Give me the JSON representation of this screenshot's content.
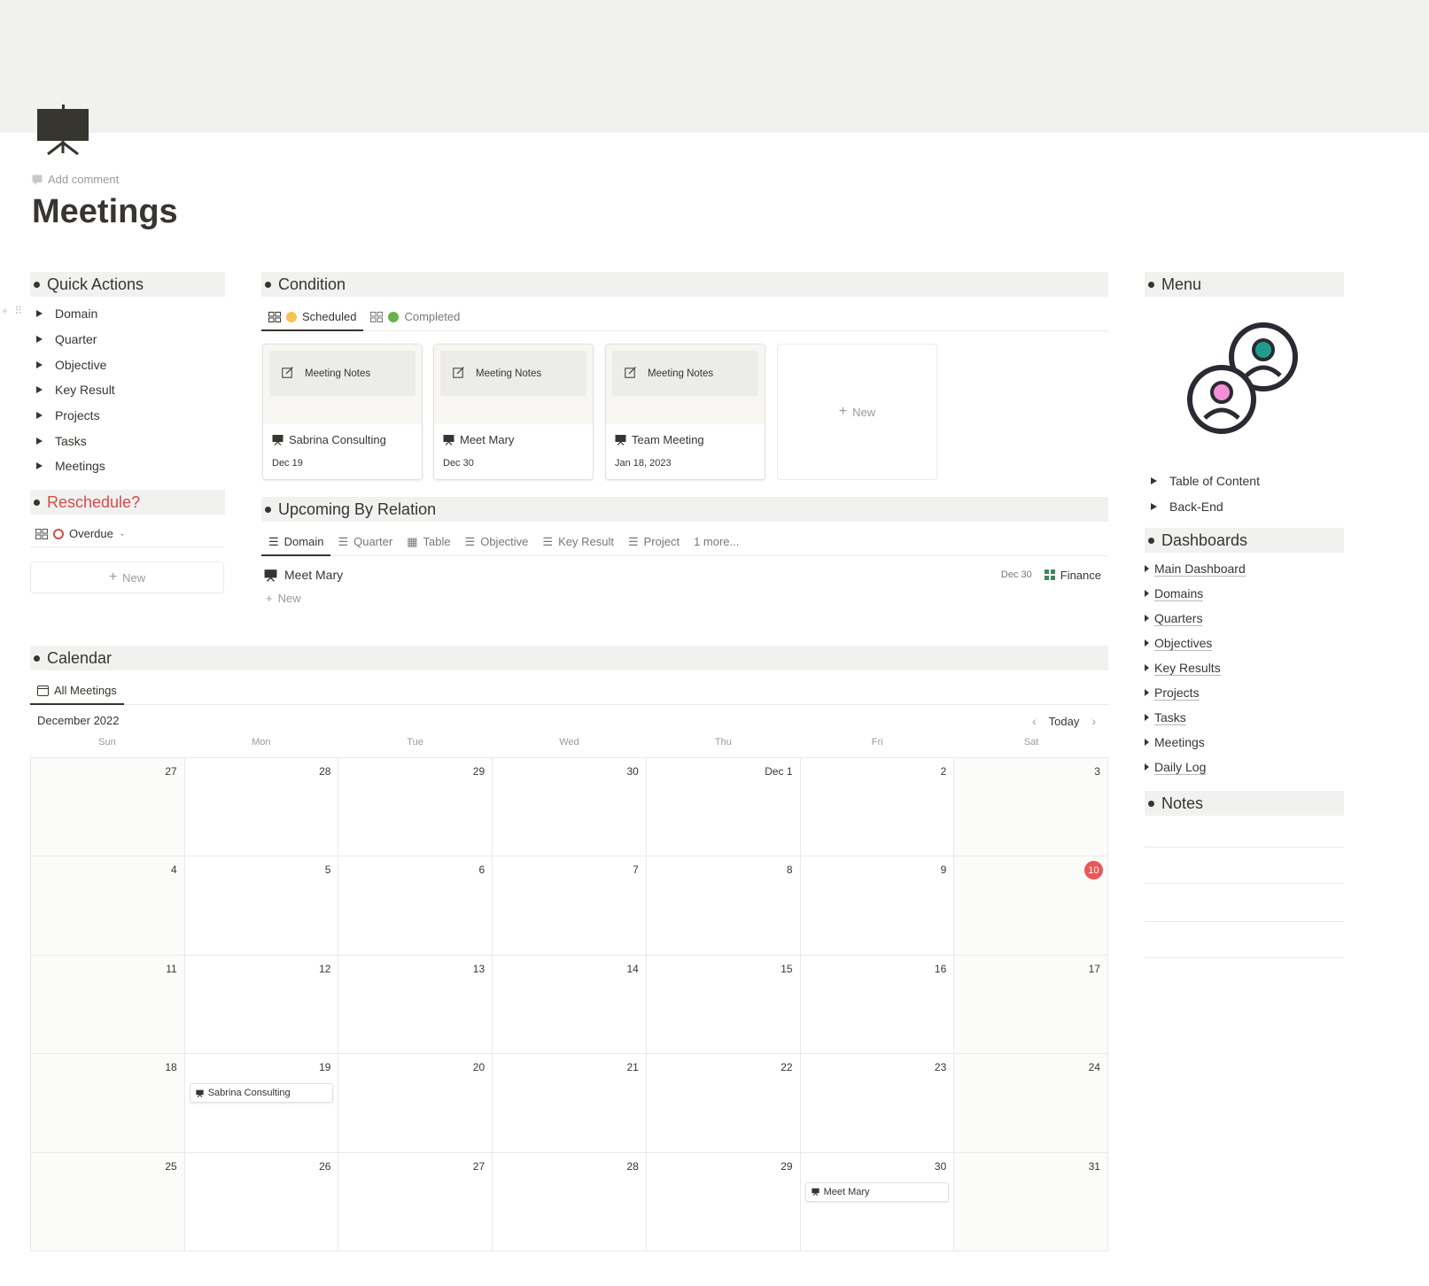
{
  "page": {
    "title": "Meetings",
    "add_comment": "Add comment"
  },
  "quick_actions": {
    "heading": "Quick Actions",
    "items": [
      "Domain",
      "Quarter",
      "Objective",
      "Key Result",
      "Projects",
      "Tasks",
      "Meetings"
    ]
  },
  "reschedule": {
    "heading": "Reschedule?",
    "view_label": "Overdue",
    "new_label": "New"
  },
  "condition": {
    "heading": "Condition",
    "tabs": [
      {
        "label": "Scheduled",
        "dot_color": "#f5c451"
      },
      {
        "label": "Completed",
        "dot_color": "#6ab04c"
      }
    ],
    "cards": [
      {
        "cover_label": "Meeting Notes",
        "title": "Sabrina Consulting",
        "date": "Dec 19"
      },
      {
        "cover_label": "Meeting Notes",
        "title": "Meet Mary",
        "date": "Dec 30"
      },
      {
        "cover_label": "Meeting Notes",
        "title": "Team Meeting",
        "date": "Jan 18, 2023"
      }
    ],
    "new_label": "New"
  },
  "upcoming": {
    "heading": "Upcoming By Relation",
    "tabs": [
      "Domain",
      "Quarter",
      "Table",
      "Objective",
      "Key Result",
      "Project",
      "1 more..."
    ],
    "rows": [
      {
        "title": "Meet Mary",
        "date": "Dec 30",
        "tag": "Finance"
      }
    ],
    "new_label": "New"
  },
  "calendar": {
    "heading": "Calendar",
    "view_tab": "All Meetings",
    "month_label": "December 2022",
    "today_label": "Today",
    "dows": [
      "Sun",
      "Mon",
      "Tue",
      "Wed",
      "Thu",
      "Fri",
      "Sat"
    ],
    "weeks": [
      [
        "27",
        "28",
        "29",
        "30",
        "Dec 1",
        "2",
        "3"
      ],
      [
        "4",
        "5",
        "6",
        "7",
        "8",
        "9",
        "10"
      ],
      [
        "11",
        "12",
        "13",
        "14",
        "15",
        "16",
        "17"
      ],
      [
        "18",
        "19",
        "20",
        "21",
        "22",
        "23",
        "24"
      ],
      [
        "25",
        "26",
        "27",
        "28",
        "29",
        "30",
        "31"
      ]
    ],
    "today_day": "10",
    "events": [
      {
        "week": 3,
        "day": 1,
        "title": "Sabrina Consulting"
      },
      {
        "week": 4,
        "day": 5,
        "title": "Meet Mary"
      }
    ]
  },
  "menu": {
    "heading": "Menu",
    "toggles": [
      "Table of Content",
      "Back-End"
    ]
  },
  "dashboards": {
    "heading": "Dashboards",
    "items": [
      {
        "label": "Main Dashboard",
        "link": true
      },
      {
        "label": "Domains",
        "link": true
      },
      {
        "label": "Quarters",
        "link": true
      },
      {
        "label": "Objectives",
        "link": true
      },
      {
        "label": "Key Results",
        "link": true
      },
      {
        "label": "Projects",
        "link": true
      },
      {
        "label": "Tasks",
        "link": true
      },
      {
        "label": "Meetings",
        "link": false
      },
      {
        "label": "Daily Log",
        "link": true
      }
    ]
  },
  "notes": {
    "heading": "Notes"
  },
  "colors": {
    "accent_red": "#d44c47",
    "today_red": "#eb5757",
    "header_bg": "#f1f1ef",
    "avatar_pink": "#f78fd6",
    "avatar_teal": "#1f9d8a"
  },
  "icons": {
    "page_icon": "presentation-board-icon",
    "menu_illustration": "users-group-icon"
  }
}
